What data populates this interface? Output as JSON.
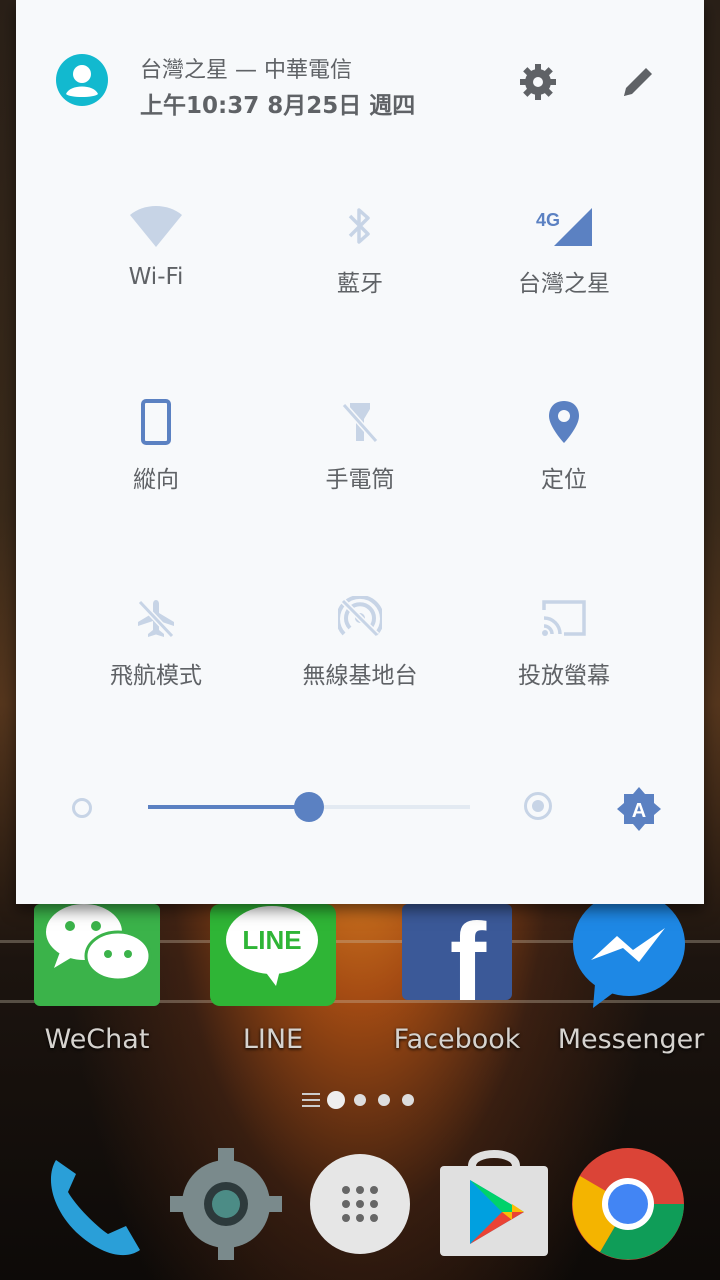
{
  "header": {
    "carrier": "台灣之星 — 中華電信",
    "datetime": "上午10:37  8月25日 週四"
  },
  "tiles": [
    {
      "label": "Wi-Fi",
      "icon": "wifi-icon"
    },
    {
      "label": "藍牙",
      "icon": "bluetooth-icon"
    },
    {
      "label": "台灣之星",
      "icon": "cellular-4g-icon"
    },
    {
      "label": "縱向",
      "icon": "portrait-rotation-icon"
    },
    {
      "label": "手電筒",
      "icon": "flashlight-off-icon"
    },
    {
      "label": "定位",
      "icon": "location-icon"
    },
    {
      "label": "飛航模式",
      "icon": "airplane-mode-icon"
    },
    {
      "label": "無線基地台",
      "icon": "hotspot-off-icon"
    },
    {
      "label": "投放螢幕",
      "icon": "cast-icon"
    }
  ],
  "cellular_badge": "4G",
  "brightness": {
    "level": 0.5,
    "auto_label": "A"
  },
  "apps": [
    {
      "label": "WeChat",
      "icon": "wechat-icon"
    },
    {
      "label": "LINE",
      "icon": "line-icon"
    },
    {
      "label": "Facebook",
      "icon": "facebook-icon"
    },
    {
      "label": "Messenger",
      "icon": "messenger-icon"
    }
  ],
  "app_glyphs": {
    "line": "LINE",
    "facebook": "f"
  },
  "dock": [
    "phone-icon",
    "settings-icon",
    "app-drawer-icon",
    "play-store-icon",
    "chrome-icon"
  ],
  "colors": {
    "accent": "#5b81c2",
    "inactive": "#c7d4e6",
    "avatar": "#12b9cf"
  }
}
